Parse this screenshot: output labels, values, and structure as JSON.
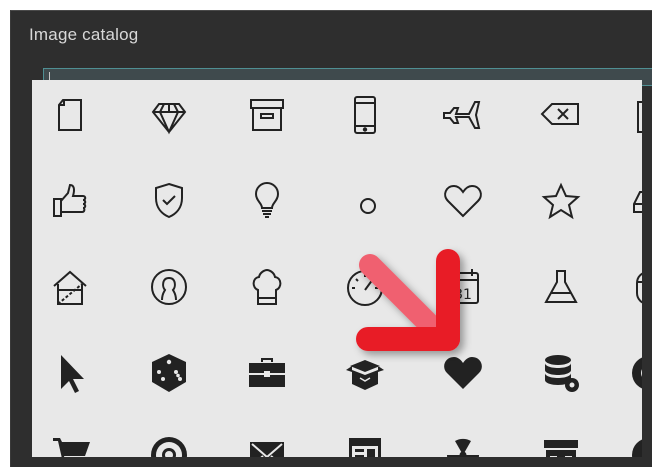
{
  "window": {
    "title": "Image catalog"
  },
  "search": {
    "value": "",
    "placeholder": ""
  },
  "accent_color": "#e8202a",
  "icons": [
    [
      "document-icon",
      "diamond-icon",
      "archive-box-icon",
      "smartphone-icon",
      "airplane-icon",
      "backspace-icon",
      "clipboard-icon"
    ],
    [
      "thumbs-up-icon",
      "shield-check-icon",
      "lightbulb-icon",
      "hidden-by-arrow-icon",
      "heart-outline-icon",
      "star-outline-icon",
      "hard-drive-icon"
    ],
    [
      "house-frame-icon",
      "user-circle-icon",
      "chef-hat-icon",
      "speedometer-icon",
      "calendar-icon",
      "flask-icon",
      "mouse-icon"
    ],
    [
      "cursor-arrow-icon",
      "dice-icon",
      "briefcase-icon",
      "open-box-icon",
      "heart-filled-icon",
      "database-gear-icon",
      "lifebuoy-partial-icon"
    ],
    [
      "shopping-cart-icon",
      "lifebuoy-icon",
      "envelope-icon",
      "browser-window-icon",
      "radiation-icon",
      "storefront-icon",
      "chart-partial-icon"
    ]
  ],
  "calendar_day": "31"
}
